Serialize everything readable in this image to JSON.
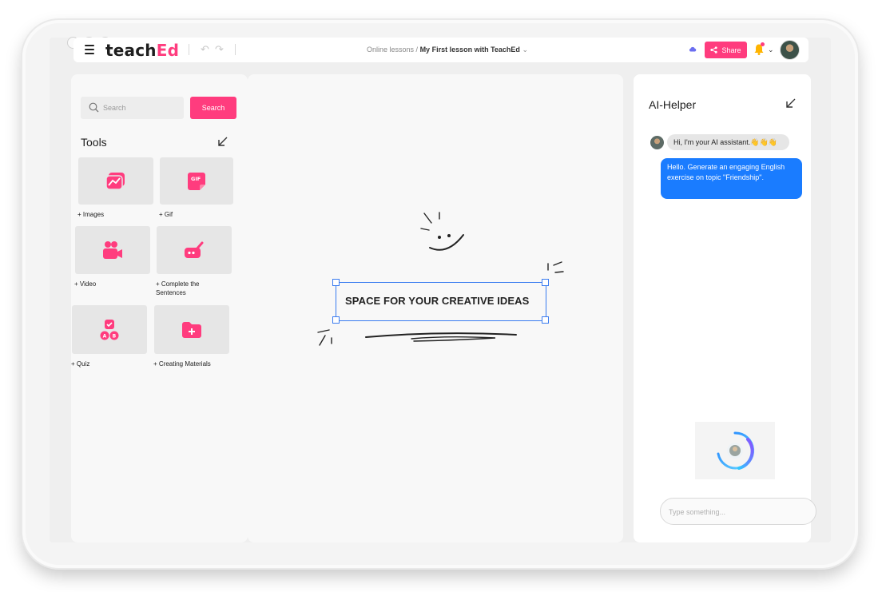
{
  "app": {
    "logo_main": "teach",
    "logo_accent": "Ed"
  },
  "header": {
    "breadcrumb_parent": "Online lessons /",
    "breadcrumb_current": "My First lesson with TeachEd",
    "share_label": "Share",
    "icons": [
      "menu-icon",
      "undo-icon",
      "redo-icon",
      "chevron-down-icon",
      "cloud-icon",
      "share-icon",
      "bell-icon",
      "avatar"
    ]
  },
  "sidebar": {
    "search_placeholder": "Search",
    "search_button": "Search",
    "tools_title": "Tools",
    "tools": [
      {
        "label": "+ Images",
        "icon": "image-icon"
      },
      {
        "label": "+ Gif",
        "icon": "gif-icon"
      },
      {
        "label": "+ Video",
        "icon": "video-icon"
      },
      {
        "label": "+ Complete the Sentences",
        "icon": "edit-icon"
      },
      {
        "label": "+ Quiz",
        "icon": "quiz-icon"
      },
      {
        "label": "+ Creating Materials",
        "icon": "folder-add-icon"
      }
    ]
  },
  "canvas": {
    "text": "SPACE FOR YOUR CREATIVE IDEAS"
  },
  "ai": {
    "title": "AI-Helper",
    "greeting": "Hi, I'm your AI assistant.👋👋👋",
    "user_message": "Hello. Generate an engaging English exercise on topic \"Friendship\".",
    "input_placeholder": "Type something..."
  },
  "colors": {
    "accent": "#ff3c7e",
    "user_bubble": "#1a7cff",
    "selection": "#3a7cf0"
  }
}
